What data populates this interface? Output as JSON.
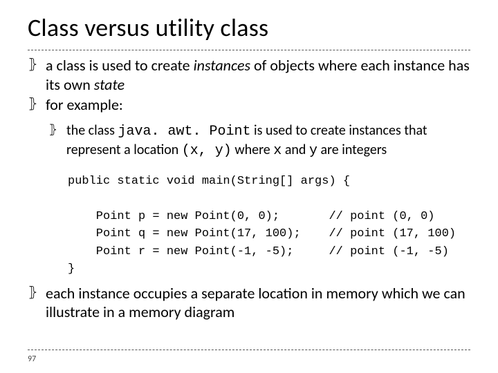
{
  "title": "Class versus utility class",
  "bullets": {
    "b0_prefix": "a class is used to create ",
    "b0_em1": "instances",
    "b0_mid": " of objects where each instance has its own ",
    "b0_em2": "state",
    "b1": "for example:",
    "sub0_prefix": "the class ",
    "sub0_code1": "java. awt. Point",
    "sub0_mid1": " is used to create instances that represent a location ",
    "sub0_code2": "(x, y)",
    "sub0_mid2": " where ",
    "sub0_code3": "x",
    "sub0_mid3": " and ",
    "sub0_code4": "y",
    "sub0_tail": " are integers",
    "b2": "each instance occupies a separate location in memory which we can illustrate in a memory diagram"
  },
  "code": "public static void main(String[] args) {\n\n    Point p = new Point(0, 0);       // point (0, 0)\n    Point q = new Point(17, 100);    // point (17, 100)\n    Point r = new Point(-1, -5);     // point (-1, -5)\n}",
  "page_number": "97"
}
